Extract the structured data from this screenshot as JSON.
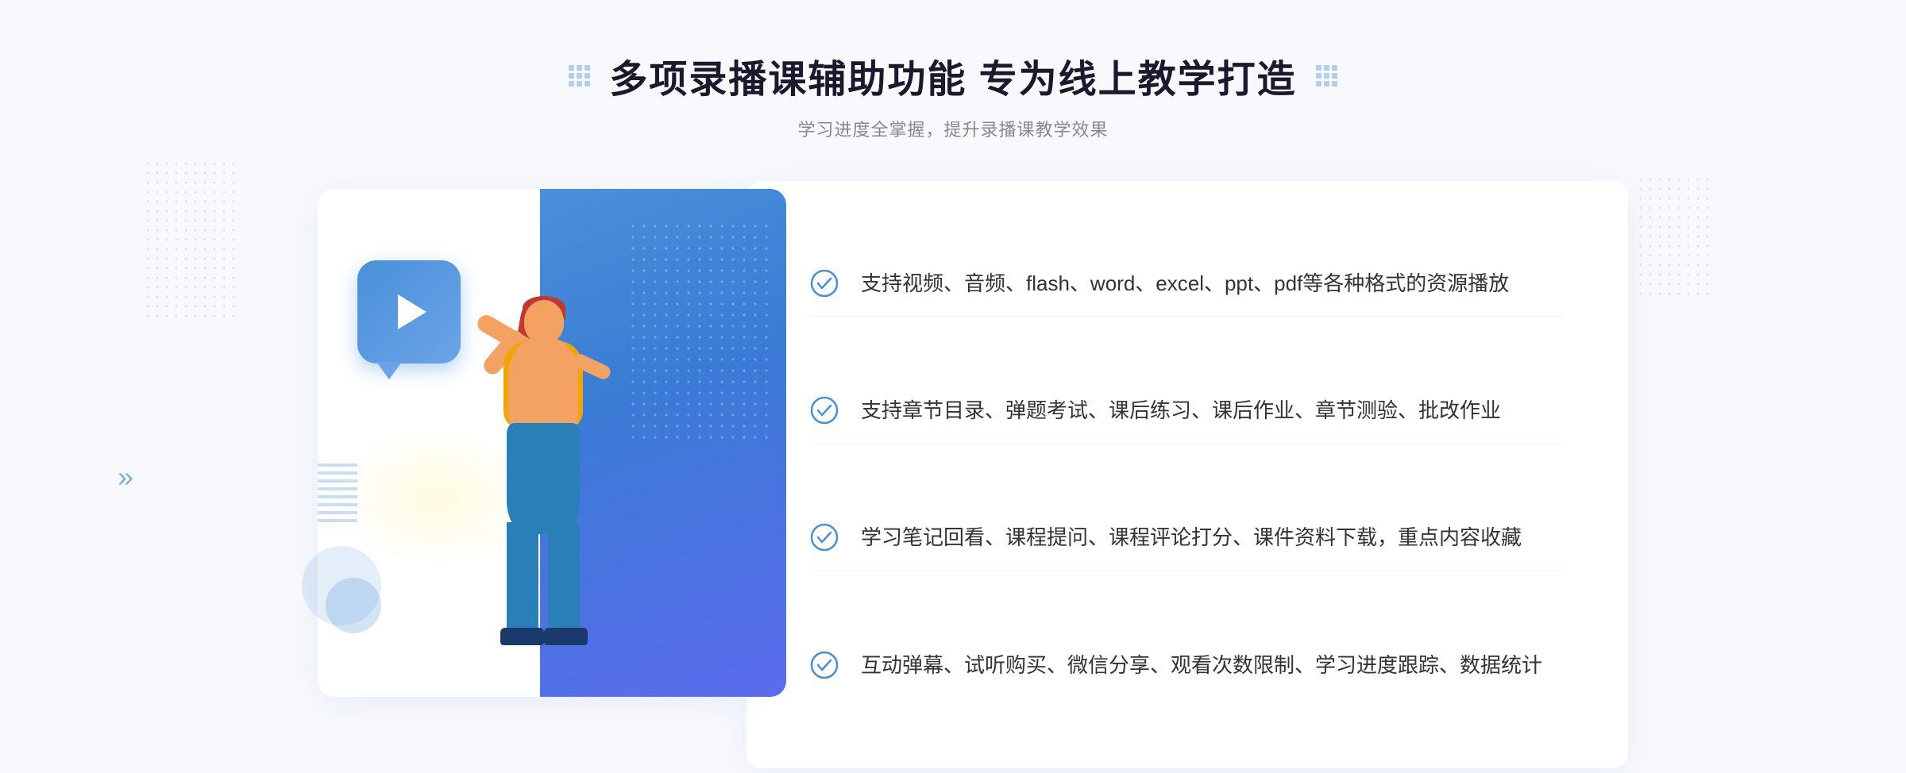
{
  "page": {
    "background_color": "#f8f9fc"
  },
  "header": {
    "title": "多项录播课辅助功能 专为线上教学打造",
    "subtitle": "学习进度全掌握，提升录播课教学效果"
  },
  "features": [
    {
      "id": 1,
      "text": "支持视频、音频、flash、word、excel、ppt、pdf等各种格式的资源播放"
    },
    {
      "id": 2,
      "text": "支持章节目录、弹题考试、课后练习、课后作业、章节测验、批改作业"
    },
    {
      "id": 3,
      "text": "学习笔记回看、课程提问、课程评论打分、课件资料下载，重点内容收藏"
    },
    {
      "id": 4,
      "text": "互动弹幕、试听购买、微信分享、观看次数限制、学习进度跟踪、数据统计"
    }
  ],
  "icons": {
    "check": "check-circle-icon",
    "play": "play-icon",
    "chevron": "chevron-left-icon"
  },
  "colors": {
    "primary": "#4a90d9",
    "title": "#1a1a2e",
    "text": "#333333",
    "subtitle": "#888888",
    "border": "#f0f4f8"
  }
}
